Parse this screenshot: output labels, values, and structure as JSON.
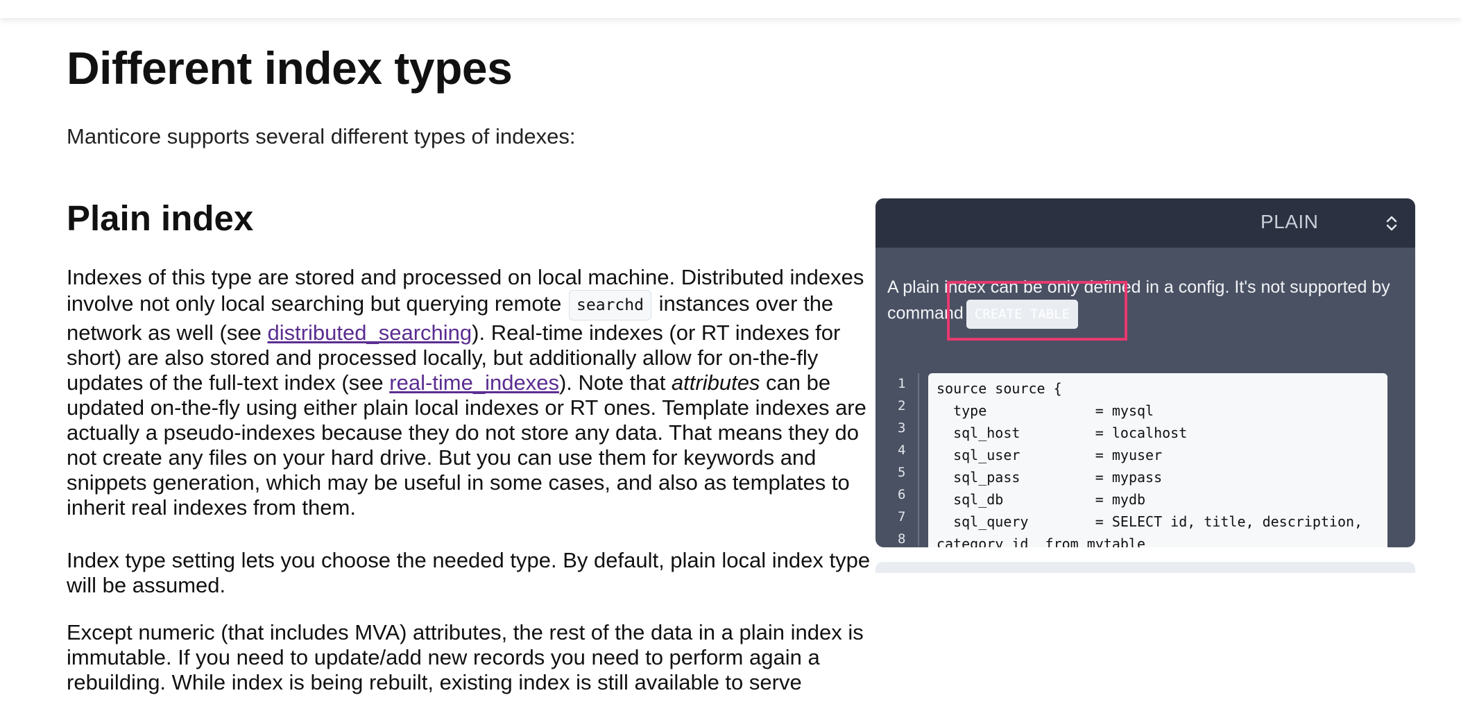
{
  "page": {
    "title": "Different index types",
    "intro": "Manticore supports several different types of indexes:"
  },
  "section": {
    "title": "Plain index",
    "p1": {
      "t1": "Indexes of this type are stored and processed on local machine. Distributed indexes involve not only local searching but querying remote ",
      "code": "searchd",
      "t2": " instances over the network as well (see ",
      "link1": "distributed_searching",
      "t3": "). Real-time indexes (or RT indexes for short) are also stored and processed locally, but additionally allow for on-the-fly updates of the full-text index (see ",
      "link2": "real-time_indexes",
      "t4": "). Note that ",
      "em": "attributes",
      "t5": " can be updated on-the-fly using either plain local indexes or RT ones. Template indexes are actually a pseudo-indexes because they do not store any data. That means they do not create any files on your hard drive. But you can use them for keywords and snippets generation, which may be useful in some cases, and also as templates to inherit real indexes from them."
    },
    "p2": "Index type setting lets you choose the needed type. By default, plain local index type will be assumed.",
    "p3": "Except numeric (that includes MVA) attributes, the rest of the data in a plain index is immutable. If you need to update/add new records you need to perform again a rebuilding. While index is being rebuilt, existing index is still available to serve"
  },
  "example_panel": {
    "selected_tab": "PLAIN",
    "chevron_icon": "chevron-up-down-icon",
    "note_text": "A plain index can be only defined in a config. It's not supported by command",
    "note_code": "CREATE TABLE",
    "line_numbers": [
      "1",
      "2",
      "3",
      "4",
      "5",
      "6",
      "7",
      "8"
    ],
    "code_lines": [
      "source source {",
      "  type             = mysql",
      "  sql_host         = localhost",
      "  sql_user         = myuser",
      "  sql_pass         = mypass",
      "  sql_db           = mydb",
      "  sql_query        = SELECT id, title, description,",
      "category_id  from mytable"
    ]
  },
  "colors": {
    "link": "#5b2d91",
    "panel_bg": "#4a5163",
    "panel_header": "#2c3142",
    "highlight": "#e8386e"
  }
}
